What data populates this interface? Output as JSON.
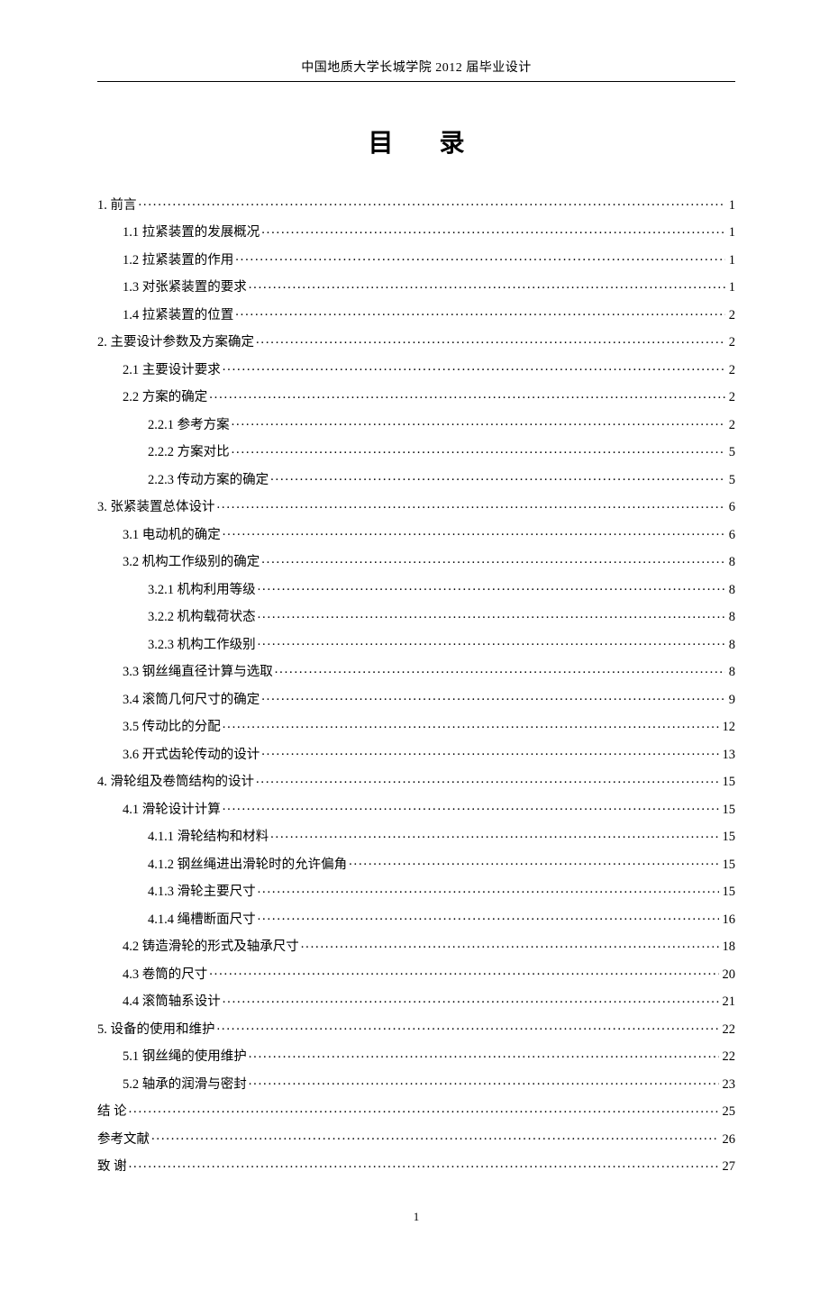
{
  "header": "中国地质大学长城学院 2012 届毕业设计",
  "title": "目 录",
  "page_number": "1",
  "toc": [
    {
      "level": 0,
      "label": "1. 前言",
      "page": "1"
    },
    {
      "level": 1,
      "label": "1.1 拉紧装置的发展概况",
      "page": "1"
    },
    {
      "level": 1,
      "label": "1.2 拉紧装置的作用",
      "page": "1"
    },
    {
      "level": 1,
      "label": "1.3 对张紧装置的要求",
      "page": "1"
    },
    {
      "level": 1,
      "label": "1.4 拉紧装置的位置",
      "page": "2"
    },
    {
      "level": 0,
      "label": "2. 主要设计参数及方案确定",
      "page": "2"
    },
    {
      "level": 1,
      "label": "2.1 主要设计要求",
      "page": "2"
    },
    {
      "level": 1,
      "label": "2.2 方案的确定",
      "page": "2"
    },
    {
      "level": 2,
      "label": "2.2.1 参考方案",
      "page": "2"
    },
    {
      "level": 2,
      "label": "2.2.2 方案对比",
      "page": "5"
    },
    {
      "level": 2,
      "label": "2.2.3 传动方案的确定",
      "page": "5"
    },
    {
      "level": 0,
      "label": "3. 张紧装置总体设计",
      "page": "6"
    },
    {
      "level": 1,
      "label": "3.1 电动机的确定",
      "page": "6"
    },
    {
      "level": 1,
      "label": "3.2 机构工作级别的确定",
      "page": "8"
    },
    {
      "level": 2,
      "label": "3.2.1 机构利用等级",
      "page": "8"
    },
    {
      "level": 2,
      "label": "3.2.2 机构载荷状态",
      "page": "8"
    },
    {
      "level": 2,
      "label": "3.2.3 机构工作级别",
      "page": "8"
    },
    {
      "level": 1,
      "label": "3.3 钢丝绳直径计算与选取",
      "page": "8"
    },
    {
      "level": 1,
      "label": "3.4 滚筒几何尺寸的确定",
      "page": "9"
    },
    {
      "level": 1,
      "label": "3.5 传动比的分配",
      "page": "12"
    },
    {
      "level": 1,
      "label": "3.6 开式齿轮传动的设计",
      "page": "13"
    },
    {
      "level": 0,
      "label": "4. 滑轮组及卷筒结构的设计",
      "page": "15"
    },
    {
      "level": 1,
      "label": "4.1 滑轮设计计算",
      "page": "15"
    },
    {
      "level": 2,
      "label": "4.1.1 滑轮结构和材料",
      "page": "15"
    },
    {
      "level": 2,
      "label": "4.1.2 钢丝绳进出滑轮时的允许偏角",
      "page": "15"
    },
    {
      "level": 2,
      "label": "4.1.3 滑轮主要尺寸",
      "page": "15"
    },
    {
      "level": 2,
      "label": "4.1.4 绳槽断面尺寸",
      "page": "16"
    },
    {
      "level": 1,
      "label": "4.2 铸造滑轮的形式及轴承尺寸",
      "page": "18"
    },
    {
      "level": 1,
      "label": "4.3 卷筒的尺寸",
      "page": "20"
    },
    {
      "level": 1,
      "label": "4.4 滚筒轴系设计",
      "page": "21"
    },
    {
      "level": 0,
      "label": "5. 设备的使用和维护",
      "page": "22"
    },
    {
      "level": 1,
      "label": "5.1 钢丝绳的使用维护",
      "page": "22"
    },
    {
      "level": 1,
      "label": "5.2 轴承的润滑与密封",
      "page": "23"
    },
    {
      "level": 0,
      "label": "结  论",
      "page": "25"
    },
    {
      "level": 0,
      "label": "参考文献",
      "page": "26"
    },
    {
      "level": 0,
      "label": "致  谢",
      "page": "27"
    }
  ]
}
